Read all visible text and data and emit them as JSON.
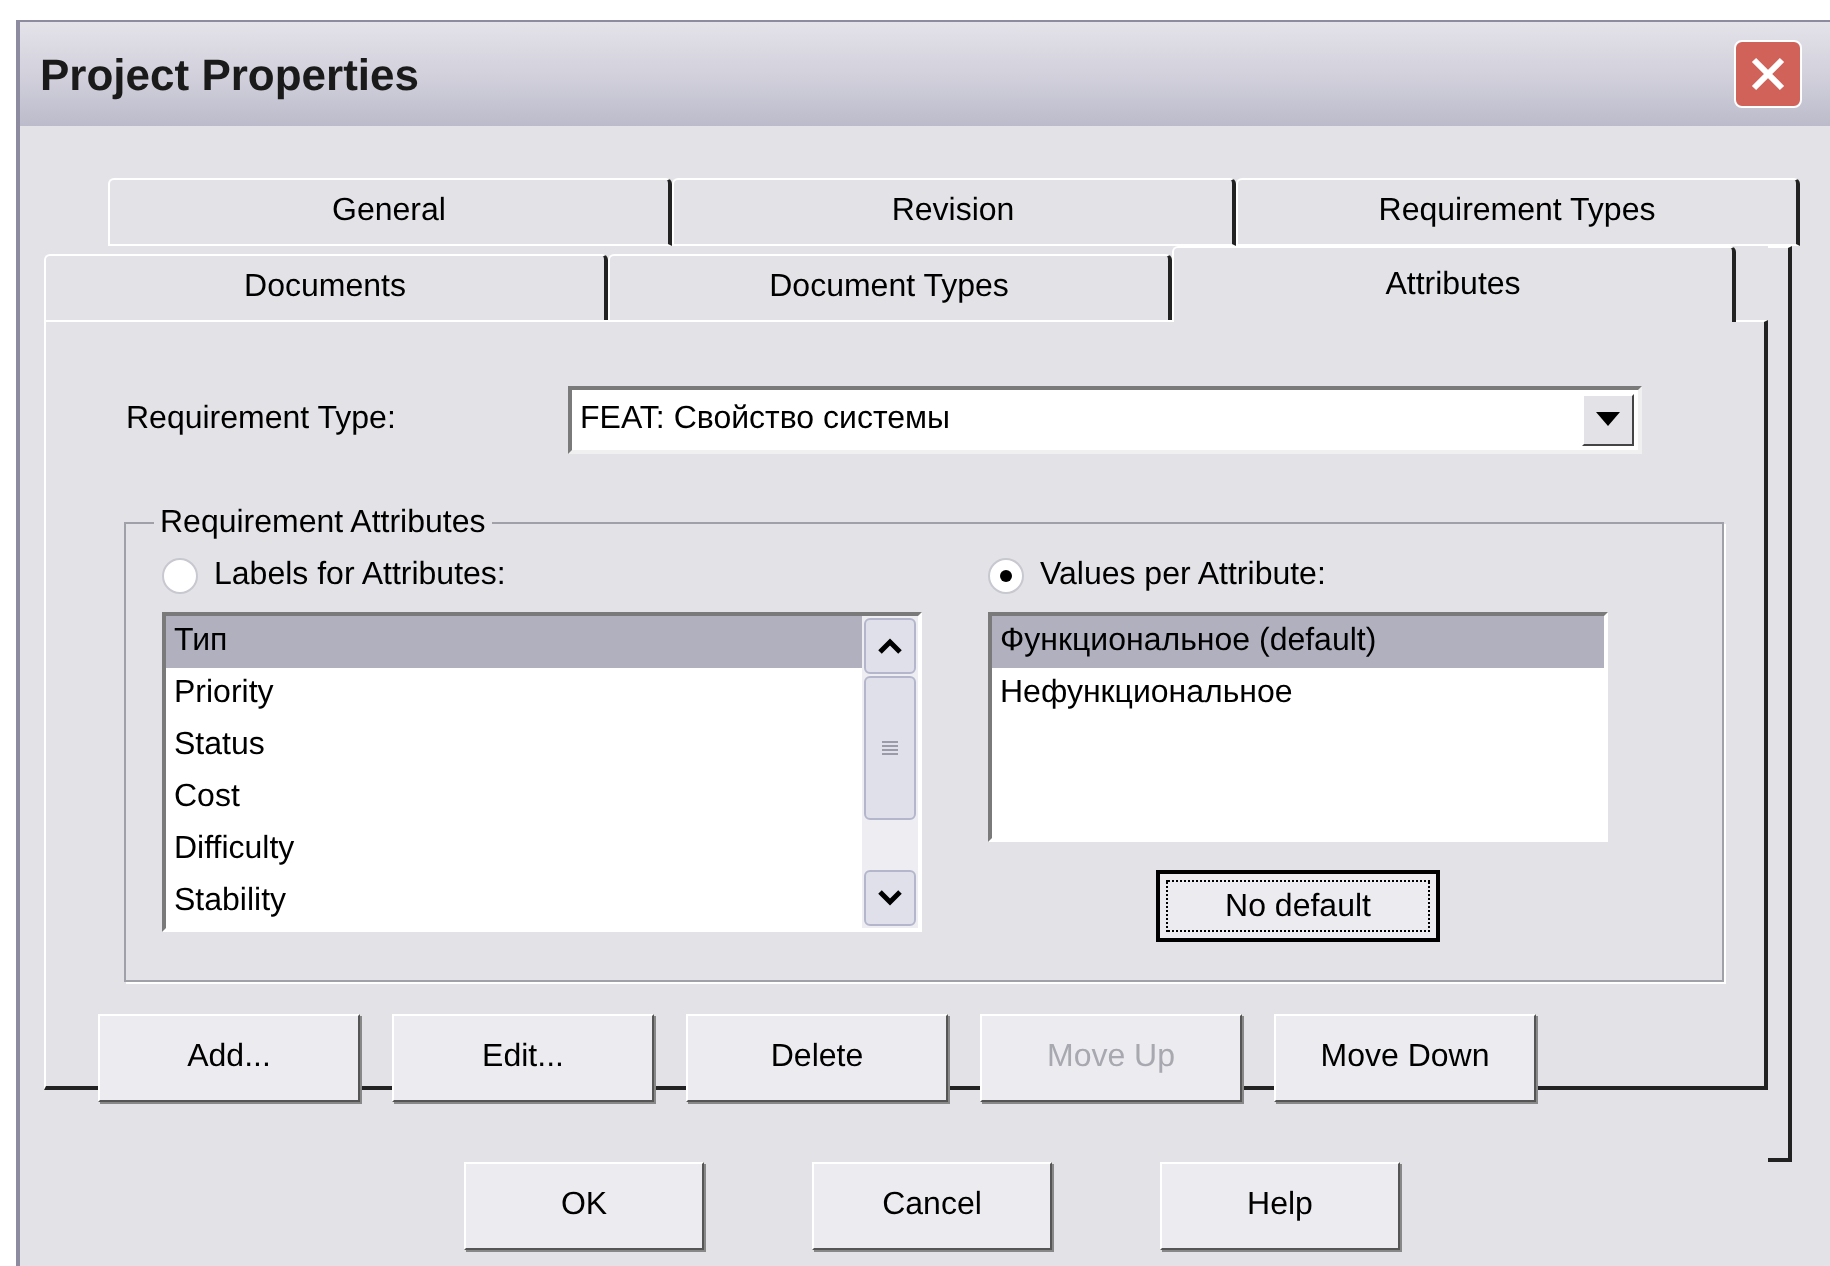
{
  "window": {
    "title": "Project Properties"
  },
  "tab_rows": [
    [
      {
        "label": "General",
        "selected": false
      },
      {
        "label": "Revision",
        "selected": false
      },
      {
        "label": "Requirement Types",
        "selected": false
      }
    ],
    [
      {
        "label": "Documents",
        "selected": false
      },
      {
        "label": "Document Types",
        "selected": false
      },
      {
        "label": "Attributes",
        "selected": true
      }
    ]
  ],
  "requirement_type": {
    "label": "Requirement Type:",
    "value": "FEAT: Свойство системы"
  },
  "group": {
    "title": "Requirement Attributes",
    "labels_radio": {
      "label": "Labels for Attributes:",
      "checked": false
    },
    "labels_list": [
      {
        "text": "Тип",
        "selected": true
      },
      {
        "text": "Priority",
        "selected": false
      },
      {
        "text": "Status",
        "selected": false
      },
      {
        "text": "Cost",
        "selected": false
      },
      {
        "text": "Difficulty",
        "selected": false
      },
      {
        "text": "Stability",
        "selected": false
      }
    ],
    "values_radio": {
      "label": "Values per Attribute:",
      "checked": true
    },
    "values_list": [
      {
        "text": "Функциональное (default)",
        "selected": true
      },
      {
        "text": "Нефункциональное",
        "selected": false
      }
    ],
    "no_default_button": {
      "label": "No default",
      "focused": true
    }
  },
  "action_buttons": [
    {
      "label": "Add...",
      "disabled": false
    },
    {
      "label": "Edit...",
      "disabled": false
    },
    {
      "label": "Delete",
      "disabled": false
    },
    {
      "label": "Move Up",
      "disabled": true
    },
    {
      "label": "Move Down",
      "disabled": false
    }
  ],
  "dialog_buttons": [
    "OK",
    "Cancel",
    "Help"
  ]
}
